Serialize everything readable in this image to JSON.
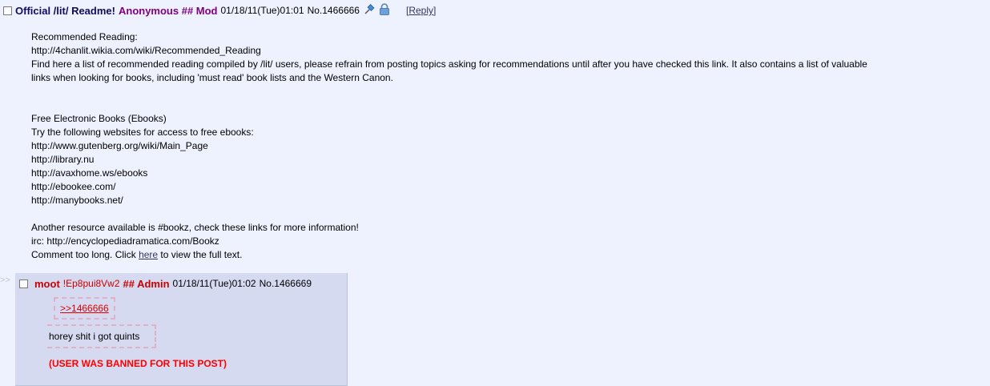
{
  "op": {
    "subject": "Official /lit/ Readme!",
    "author": "Anonymous ## Mod",
    "date": "01/18/11(Tue)01:01",
    "post_no": "No.1466666",
    "reply_open": "[",
    "reply_label": "Reply",
    "reply_close": "]",
    "body": [
      "Recommended Reading:",
      "http://4chanlit.wikia.com/wiki/Recommended_Reading",
      "Find here a list of recommended reading compiled by /lit/ users, please refrain from posting topics asking for recommendations until after you have checked this link. It also contains a list of valuable",
      "links when looking for books, including 'must read' book lists and the Western Canon.",
      "",
      "",
      "Free Electronic Books (Ebooks)",
      "Try the following websites for access to free ebooks:",
      "http://www.gutenberg.org/wiki/Main_Page",
      "http://library.nu",
      "http://avaxhome.ws/ebooks",
      "http://ebookee.com/",
      "http://manybooks.net/",
      "",
      "Another resource available is #bookz, check these links for more information!",
      "irc: http://encyclopediadramatica.com/Bookz"
    ],
    "too_long_prefix": "Comment too long. Click ",
    "too_long_link": "here",
    "too_long_suffix": " to view the full text."
  },
  "reply": {
    "arrows": ">>",
    "name": "moot",
    "trip": "!Ep8pui8Vw2",
    "capcode": "## Admin",
    "date": "01/18/11(Tue)01:02",
    "post_no": "No.1466669",
    "quote": ">>1466666",
    "message": "horey shit i got quints",
    "banned": "(USER WAS BANNED FOR THIS POST)"
  },
  "icons": [
    "sticky-pin-icon",
    "lock-icon"
  ],
  "colors": {
    "background": "#eef2ff",
    "subject": "#0f0c5d",
    "mod": "#800080",
    "admin": "#cc0000",
    "reply_bg": "#d6daf0"
  }
}
